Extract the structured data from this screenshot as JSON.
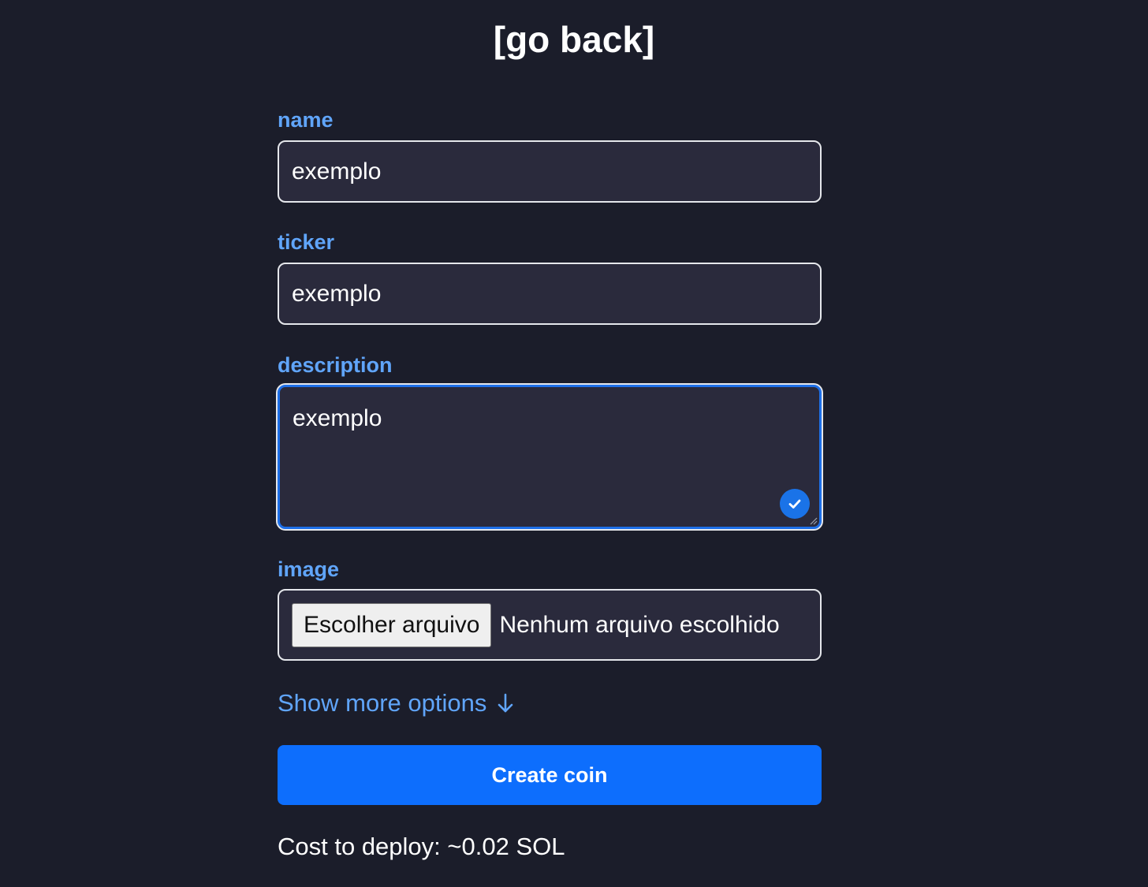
{
  "header": {
    "go_back_label": "[go back]"
  },
  "form": {
    "name": {
      "label": "name",
      "value": "exemplo"
    },
    "ticker": {
      "label": "ticker",
      "value": "exemplo"
    },
    "description": {
      "label": "description",
      "value": "exemplo"
    },
    "image": {
      "label": "image",
      "button_label": "Escolher arquivo",
      "status": "Nenhum arquivo escolhido"
    },
    "more_options_label": "Show more options",
    "submit_label": "Create coin",
    "cost_text": "Cost to deploy: ~0.02 SOL"
  },
  "icons": {
    "validation": "check-icon",
    "resize": "resize-handle-icon",
    "more_options": "arrow-down-icon"
  },
  "colors": {
    "background": "#1b1d2a",
    "field_background": "#2a2a3c",
    "label": "#60a5fa",
    "primary_button": "#0d6efd",
    "focus_border": "#1d6fe8"
  }
}
